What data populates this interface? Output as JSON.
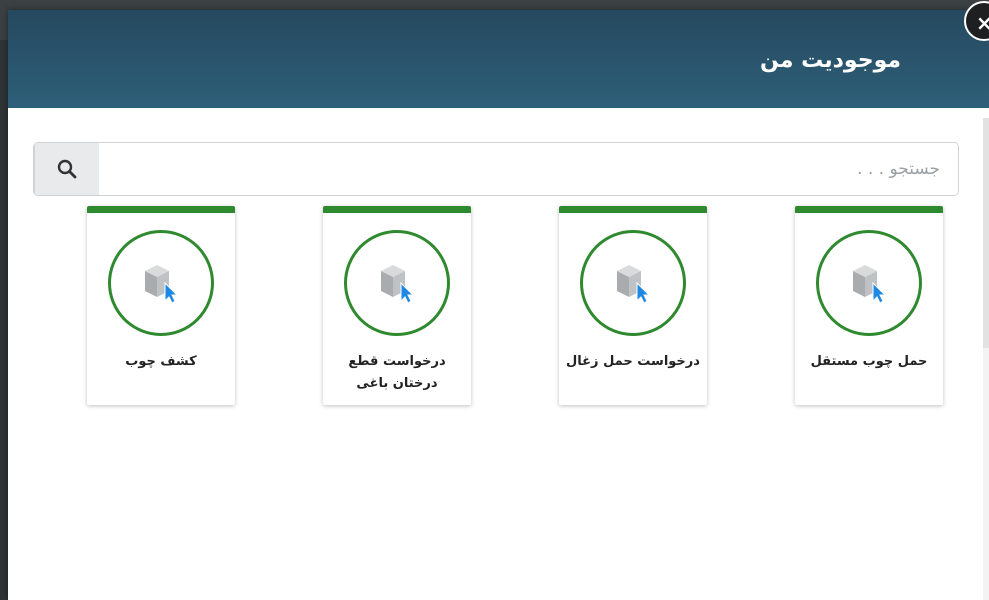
{
  "modal": {
    "title": "موجودیت من",
    "close_label": "×"
  },
  "search": {
    "placeholder": "جستجو . . ."
  },
  "cards": [
    {
      "label": "حمل چوب مستقل",
      "icon": "cube-cursor-icon"
    },
    {
      "label": "درخواست حمل زغال",
      "icon": "cube-cursor-icon"
    },
    {
      "label": "درخواست قطع درختان باغی",
      "icon": "cube-cursor-icon"
    },
    {
      "label": "کشف چوب",
      "icon": "cube-cursor-icon"
    }
  ],
  "colors": {
    "header": "#2e5f79",
    "accent": "#2f8a2f",
    "cursor": "#1e88e5"
  }
}
